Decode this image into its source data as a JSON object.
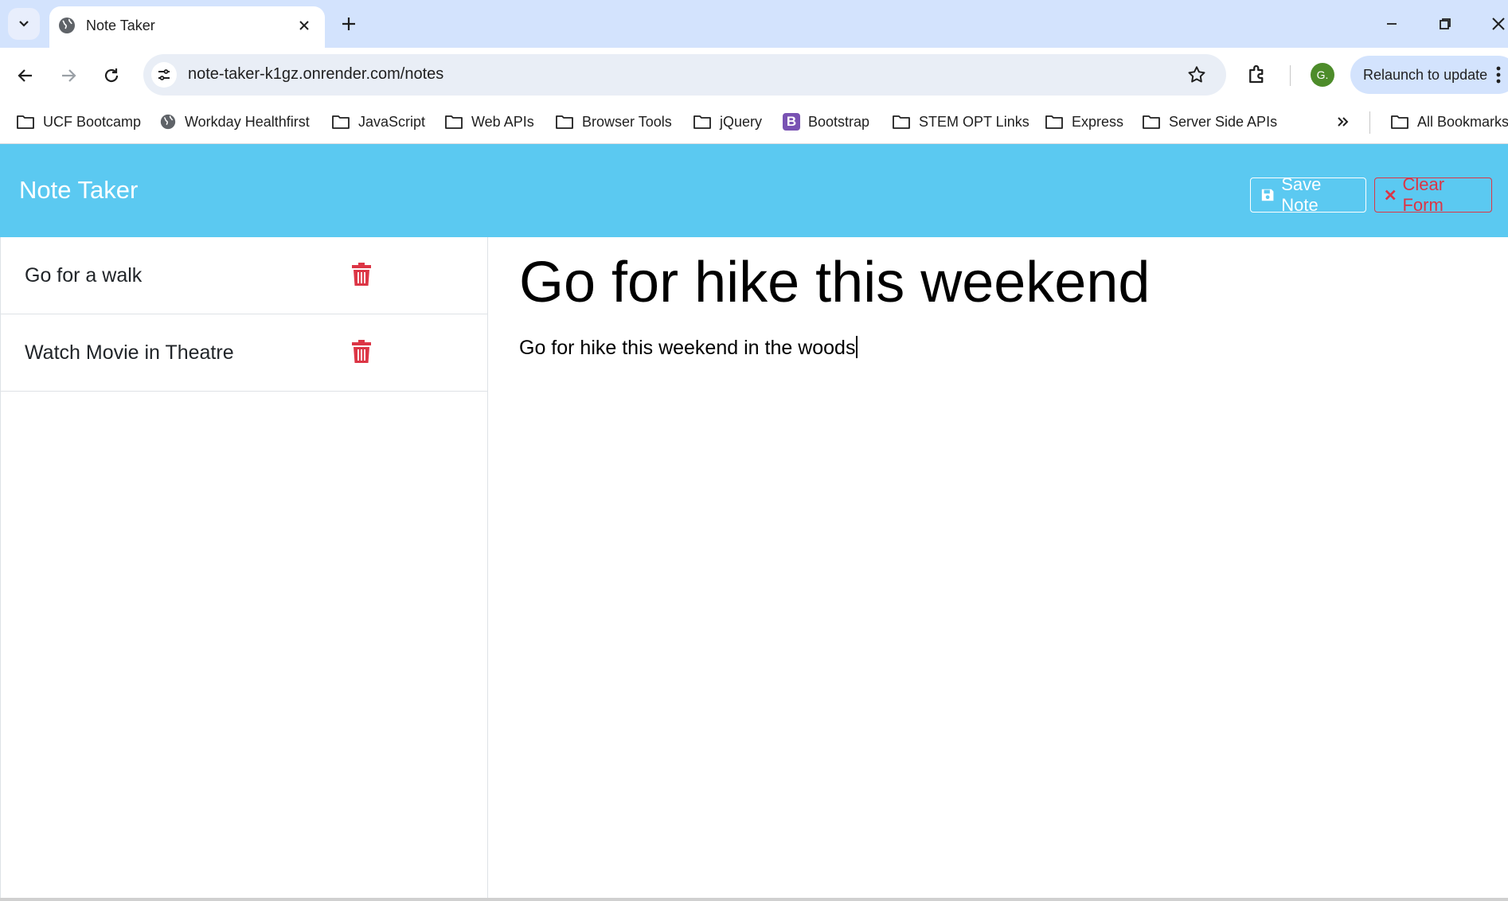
{
  "browser": {
    "tab_title": "Note Taker",
    "url": "note-taker-k1gz.onrender.com/notes",
    "profile_initial": "G.",
    "relaunch_label": "Relaunch to update",
    "bookmarks": [
      {
        "label": "UCF Bootcamp",
        "icon": "folder-icon"
      },
      {
        "label": "Workday Healthfirst",
        "icon": "globe-icon"
      },
      {
        "label": "JavaScript",
        "icon": "folder-icon"
      },
      {
        "label": "Web APIs",
        "icon": "folder-icon"
      },
      {
        "label": "Browser Tools",
        "icon": "folder-icon"
      },
      {
        "label": "jQuery",
        "icon": "folder-icon"
      },
      {
        "label": "Bootstrap",
        "icon": "bootstrap-icon",
        "icon_letter": "B"
      },
      {
        "label": "STEM OPT Links",
        "icon": "folder-icon"
      },
      {
        "label": "Express",
        "icon": "folder-icon"
      },
      {
        "label": "Server Side APIs",
        "icon": "folder-icon"
      }
    ],
    "all_bookmarks_label": "All Bookmarks"
  },
  "app": {
    "title": "Note Taker",
    "save_label": "Save Note",
    "clear_label": "Clear Form",
    "notes": [
      {
        "title": "Go for a walk"
      },
      {
        "title": "Watch Movie in Theatre"
      }
    ],
    "active_note": {
      "title": "Go for hike this weekend",
      "text": "Go for hike this weekend in the woods"
    }
  },
  "colors": {
    "navbar": "#5bc9f1",
    "danger": "#dc3545",
    "tabstrip": "#d3e3fd"
  }
}
